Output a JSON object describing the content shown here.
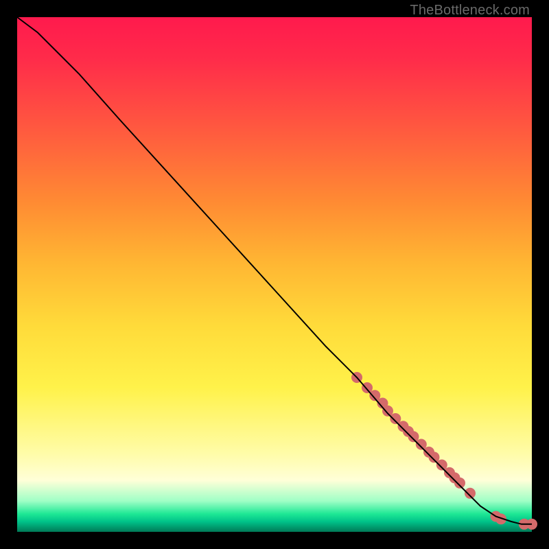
{
  "watermark": "TheBottleneck.com",
  "chart_data": {
    "type": "line",
    "title": "",
    "xlabel": "",
    "ylabel": "",
    "xlim": [
      0,
      100
    ],
    "ylim": [
      0,
      100
    ],
    "grid": false,
    "legend": false,
    "series": [
      {
        "name": "curve",
        "color": "#000000",
        "x": [
          0,
          4,
          8,
          12,
          20,
          30,
          40,
          50,
          60,
          66,
          72,
          78,
          82,
          86,
          90,
          93,
          96,
          98,
          100
        ],
        "y": [
          100,
          97,
          93,
          89,
          80,
          69,
          58,
          47,
          36,
          30,
          23,
          17,
          13,
          9,
          5,
          3,
          2,
          1.5,
          1.5
        ]
      }
    ],
    "markers": [
      {
        "name": "dots",
        "color": "#d46a6a",
        "radius_px": 8,
        "x": [
          66,
          68,
          69.5,
          71,
          72,
          73.5,
          75,
          76,
          77,
          78.5,
          80,
          81,
          82.5,
          84,
          85,
          86,
          88,
          93,
          94,
          98.5,
          100
        ],
        "y": [
          30,
          28,
          26.5,
          25,
          23.5,
          22,
          20.5,
          19.5,
          18.5,
          17,
          15.5,
          14.5,
          13,
          11.5,
          10.5,
          9.5,
          7.5,
          3,
          2.5,
          1.5,
          1.5
        ]
      }
    ]
  }
}
